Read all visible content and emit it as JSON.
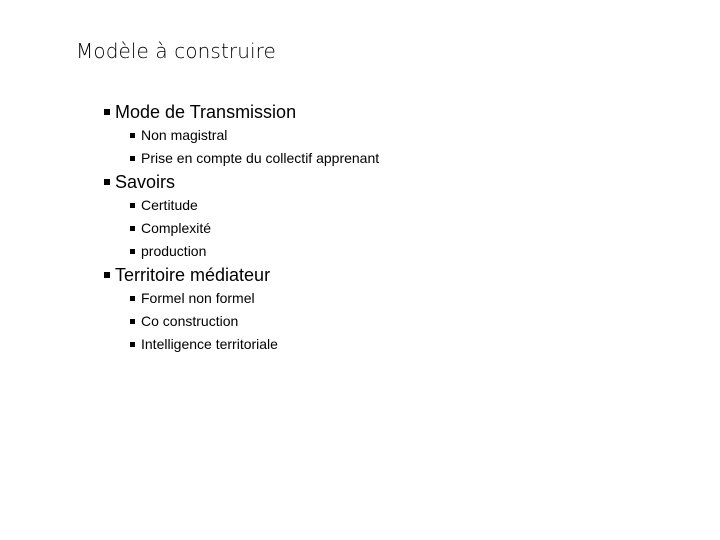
{
  "slide": {
    "title": "Modèle à construire",
    "background_color": "#FFFFFF",
    "text_color": "#000000",
    "bullet_glyph": "black-square",
    "outline": [
      {
        "label": "Mode de Transmission",
        "children": [
          {
            "label": "Non magistral"
          },
          {
            "label": "Prise en compte du collectif apprenant"
          }
        ]
      },
      {
        "label": "Savoirs",
        "children": [
          {
            "label": "Certitude"
          },
          {
            "label": "Complexité"
          },
          {
            "label": "production"
          }
        ]
      },
      {
        "label": "Territoire médiateur",
        "children": [
          {
            "label": "Formel non formel"
          },
          {
            "label": "Co construction"
          },
          {
            "label": "Intelligence territoriale"
          }
        ]
      }
    ]
  }
}
